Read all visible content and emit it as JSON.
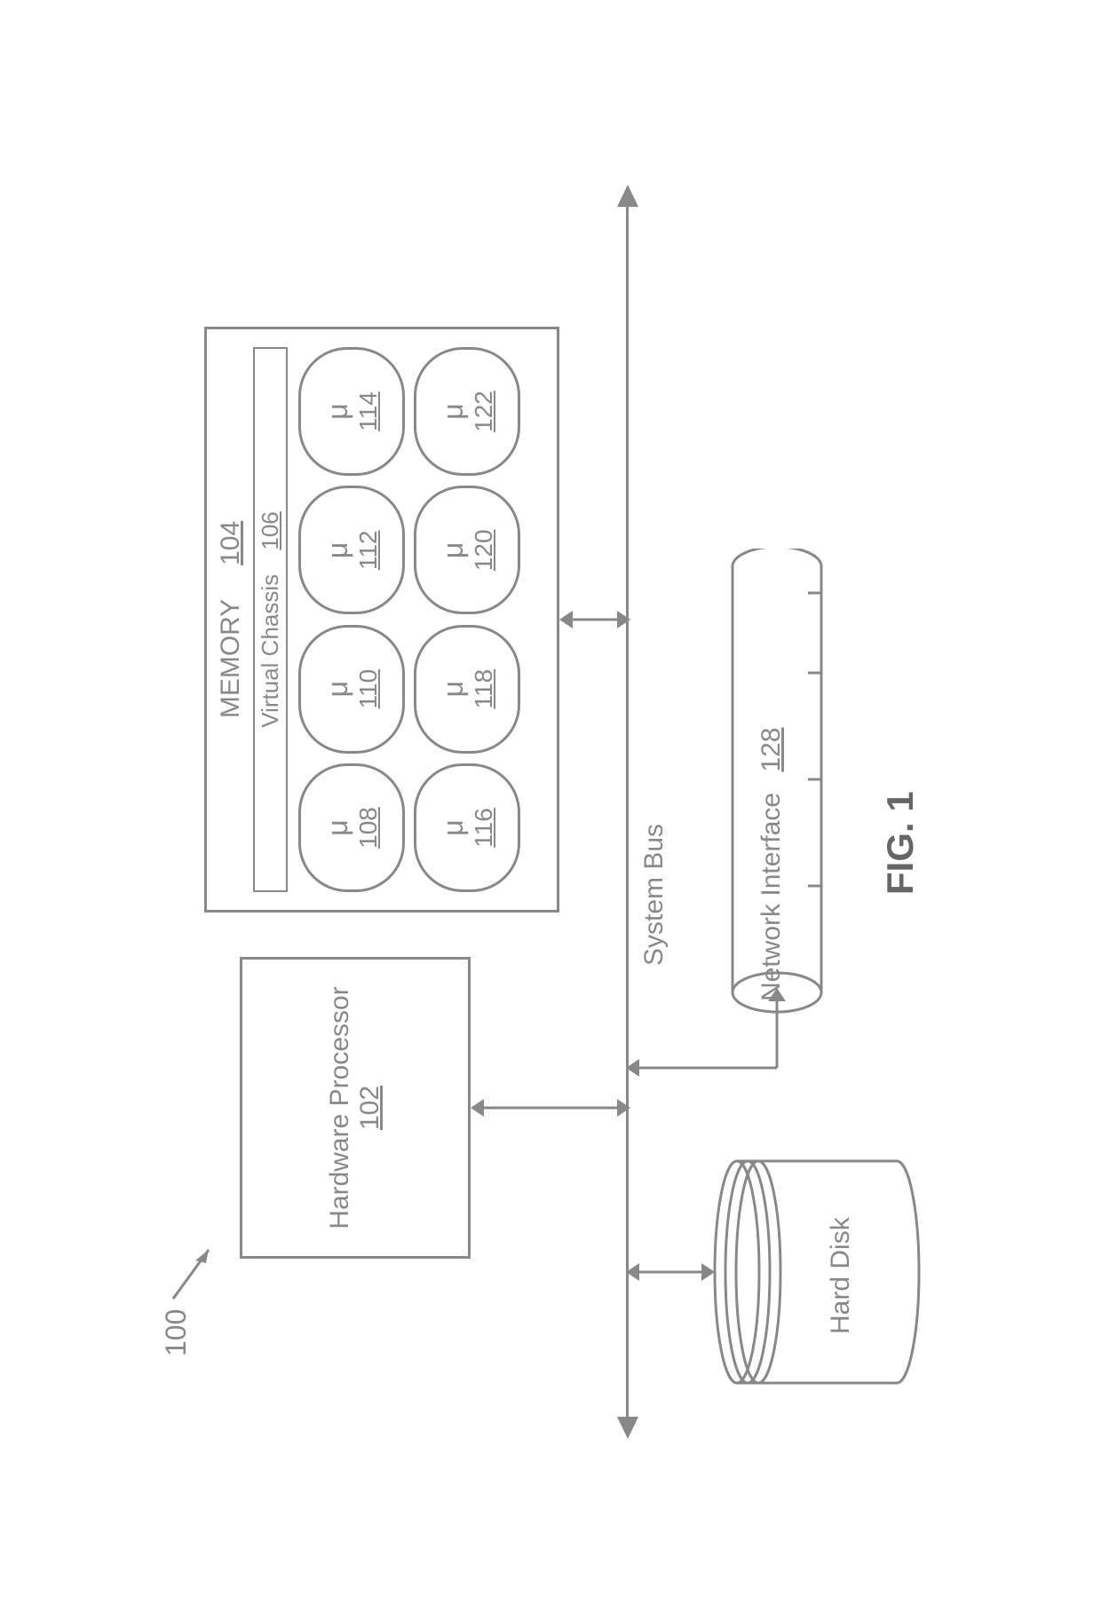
{
  "system_ref": "100",
  "hw_processor": {
    "label": "Hardware Processor",
    "ref": "102"
  },
  "memory": {
    "label": "MEMORY",
    "ref": "104",
    "virtual_chassis": {
      "label": "Virtual Chassis",
      "ref": "106"
    },
    "microservices": [
      {
        "symbol": "μ",
        "ref": "108"
      },
      {
        "symbol": "μ",
        "ref": "110"
      },
      {
        "symbol": "μ",
        "ref": "112"
      },
      {
        "symbol": "μ",
        "ref": "114"
      },
      {
        "symbol": "μ",
        "ref": "116"
      },
      {
        "symbol": "μ",
        "ref": "118"
      },
      {
        "symbol": "μ",
        "ref": "120"
      },
      {
        "symbol": "μ",
        "ref": "122"
      }
    ]
  },
  "system_bus": "System Bus",
  "hard_disk": "Hard Disk",
  "network_interface": {
    "label": "Network Interface",
    "ref": "128"
  },
  "figure_label": "FIG. 1"
}
